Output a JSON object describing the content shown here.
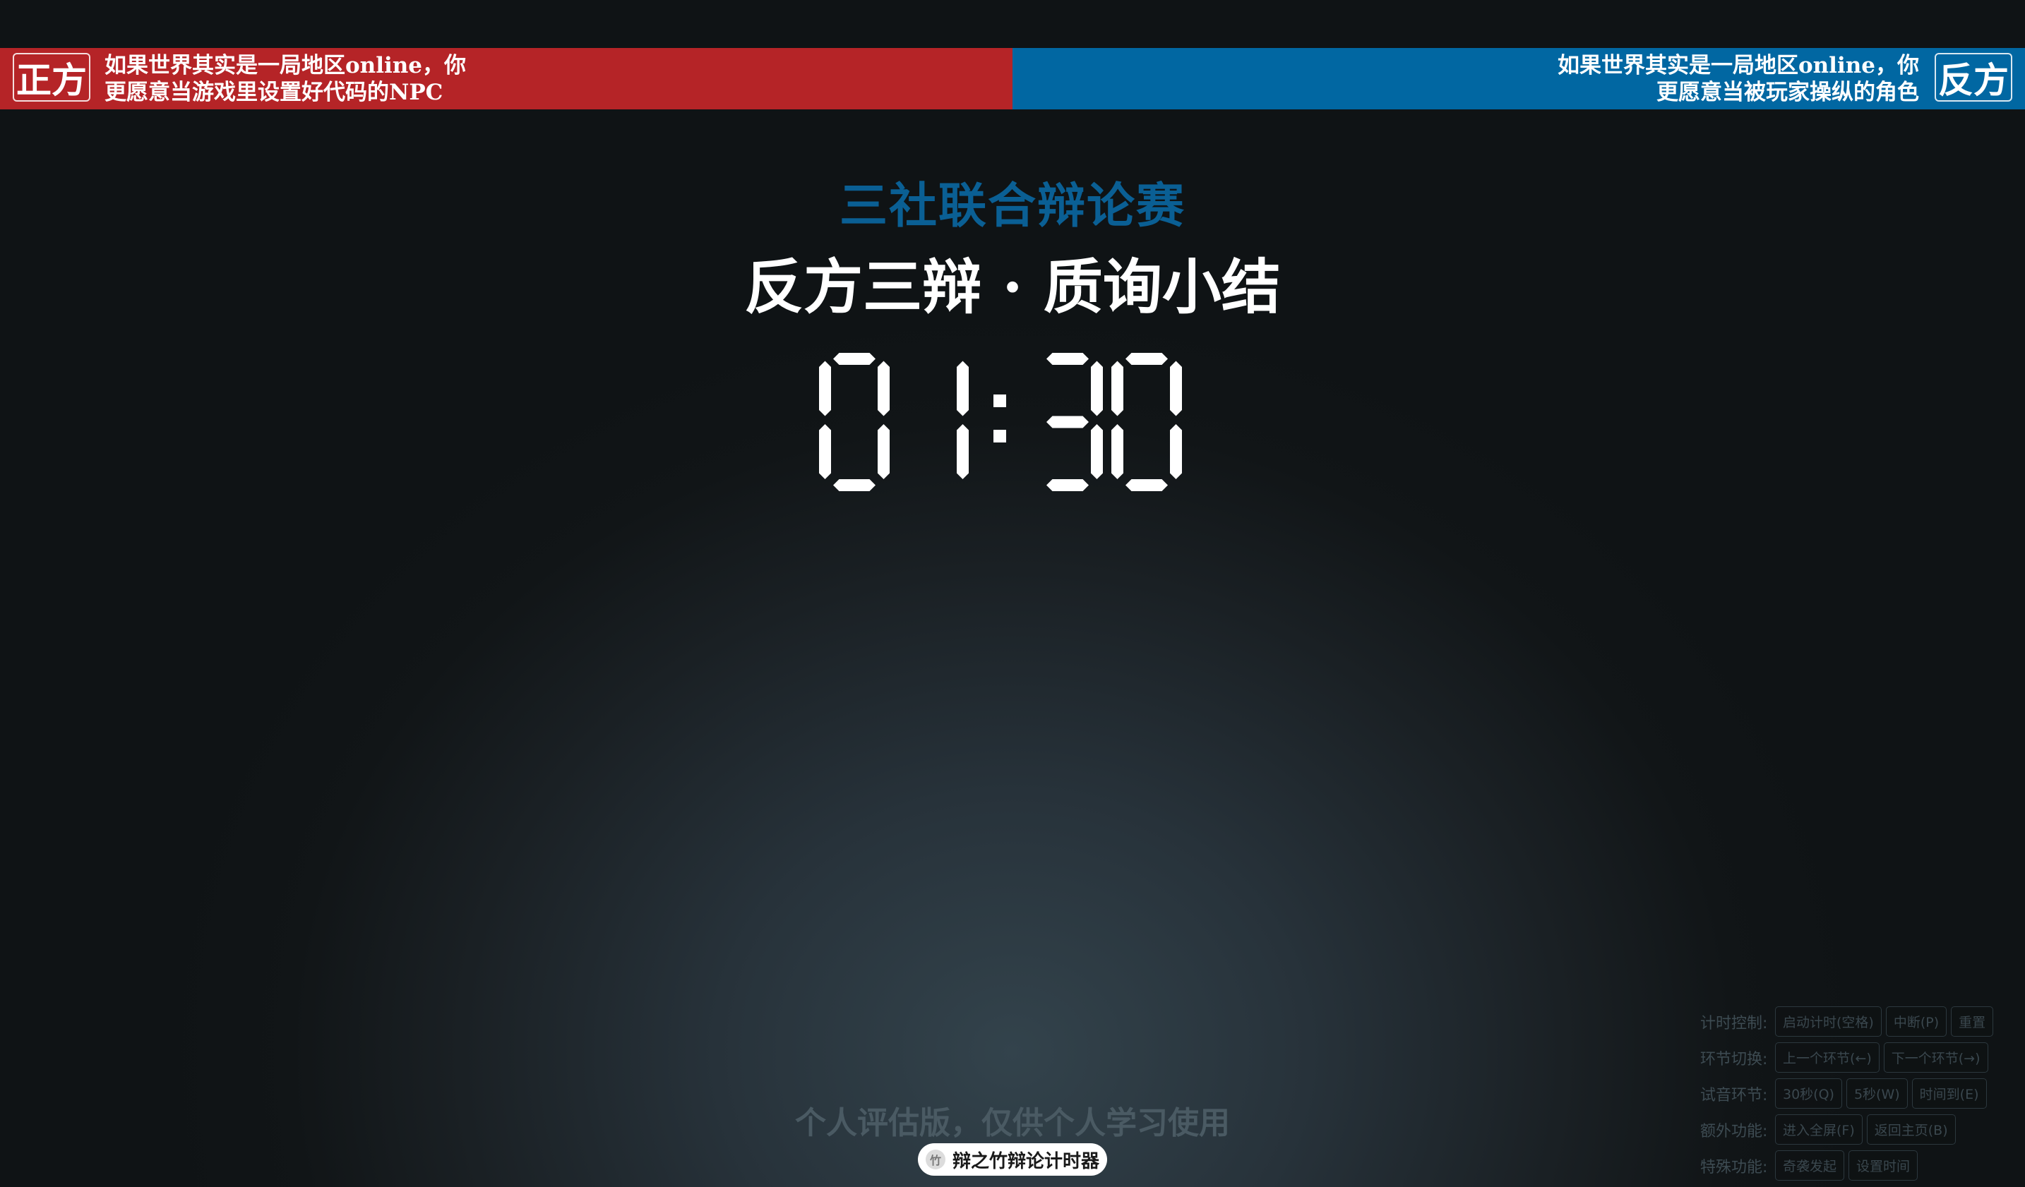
{
  "affirmative": {
    "badge": "正方",
    "motion_line1": "如果世界其实是一局地区online，你",
    "motion_line2": "更愿意当游戏里设置好代码的NPC",
    "color": "#b52427"
  },
  "negative": {
    "badge": "反方",
    "motion_line1": "如果世界其实是一局地区online，你",
    "motion_line2": "更愿意当被玩家操纵的角色",
    "color": "#0167a2"
  },
  "event_title": "三社联合辩论赛",
  "stage_title": "反方三辩 · 质询小结",
  "timer": {
    "value": "01:30",
    "digits": [
      "0",
      "1",
      "3",
      "0"
    ]
  },
  "watermark": "个人评估版，仅供个人学习使用",
  "brand": {
    "label": "辩之竹辩论计时器",
    "icon": "bamboo-logo-icon"
  },
  "controls": [
    {
      "label": "计时控制:",
      "buttons": [
        "启动计时(空格)",
        "中断(P)",
        "重置"
      ]
    },
    {
      "label": "环节切换:",
      "buttons": [
        "上一个环节(←)",
        "下一个环节(→)"
      ]
    },
    {
      "label": "试音环节:",
      "buttons": [
        "30秒(Q)",
        "5秒(W)",
        "时间到(E)"
      ]
    },
    {
      "label": "额外功能:",
      "buttons": [
        "进入全屏(F)",
        "返回主页(B)"
      ]
    },
    {
      "label": "特殊功能:",
      "buttons": [
        "奇袭发起",
        "设置时间"
      ]
    }
  ]
}
